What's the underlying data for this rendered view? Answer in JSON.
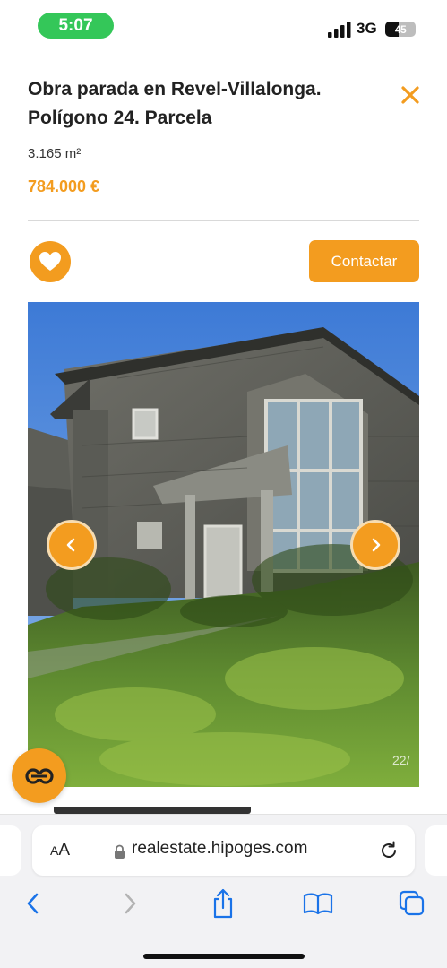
{
  "status_bar": {
    "time": "5:07",
    "network": "3G",
    "battery": "45",
    "battery_level": 0.45,
    "time_pill_color": "#34c759"
  },
  "listing": {
    "title": "Obra parada en Revel-Villalonga. Polígono 24. Parcela",
    "area": "3.165 m²",
    "price": "784.000 €",
    "accent_color": "#f39c1f"
  },
  "actions": {
    "favorite_icon": "heart-icon",
    "contact_label": "Contactar",
    "close_icon": "close-icon"
  },
  "gallery": {
    "counter": "22/",
    "prev_icon": "chevron-left-icon",
    "next_icon": "chevron-right-icon"
  },
  "chat": {
    "icon": "chat-logo-icon"
  },
  "browser": {
    "text_size_label_small": "A",
    "text_size_label_large": "A",
    "url": "realestate.hipoges.com",
    "toolbar_icons": [
      "back-icon",
      "forward-icon",
      "share-icon",
      "bookmarks-icon",
      "tabs-icon"
    ]
  }
}
